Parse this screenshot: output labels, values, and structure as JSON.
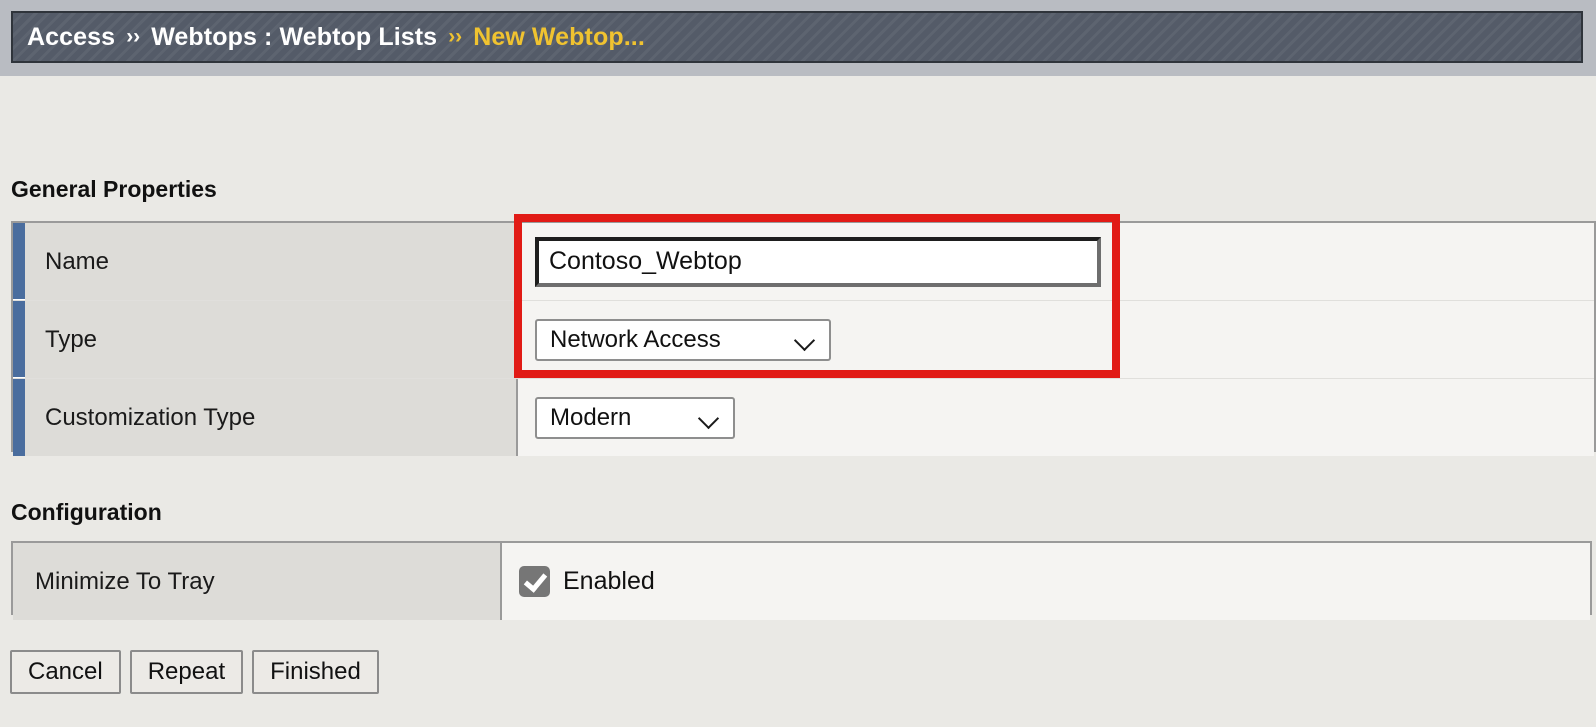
{
  "breadcrumb": {
    "separator": "››",
    "items": [
      {
        "label": "Access",
        "current": false
      },
      {
        "label": "Webtops : Webtop Lists",
        "current": false
      },
      {
        "label": "New Webtop...",
        "current": true
      }
    ],
    "accent_color": "#f0c330",
    "bar_color": "#545b68"
  },
  "sections": {
    "general": {
      "title": "General Properties",
      "rows": [
        {
          "label": "Name",
          "control": "text",
          "value": "Contoso_Webtop",
          "placeholder": ""
        },
        {
          "label": "Type",
          "control": "select",
          "value": "Network Access"
        },
        {
          "label": "Customization Type",
          "control": "select",
          "value": "Modern"
        }
      ]
    },
    "configuration": {
      "title": "Configuration",
      "rows": [
        {
          "label": "Minimize To Tray",
          "control": "checkbox",
          "value": "Enabled",
          "checked": true
        }
      ]
    }
  },
  "icons": {
    "chevron_down": "chevron-down-icon",
    "checkmark": "checkmark-icon"
  },
  "annotation": {
    "type": "red-highlight-box",
    "color": "#e11b16",
    "targets": "Name and Type rows"
  },
  "buttons": [
    {
      "label": "Cancel"
    },
    {
      "label": "Repeat"
    },
    {
      "label": "Finished"
    }
  ]
}
